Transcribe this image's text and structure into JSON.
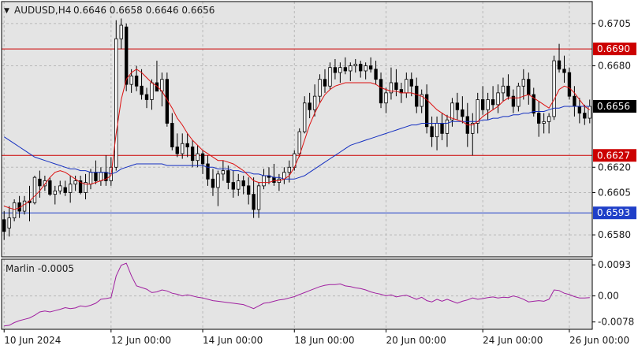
{
  "header": {
    "menu_glyph": "▼",
    "symbol": "AUDUSD,H4",
    "ohlc": "0.6646 0.6658 0.6646 0.6656"
  },
  "indicator": {
    "label": "Marlin -0.0005"
  },
  "colors": {
    "background": "#e4e4e4",
    "bull_body": "#ffffff",
    "bear_body": "#000000",
    "candle_outline": "#000000",
    "red_level": "#cc0000",
    "blue_level": "#1f3fc8",
    "fast_ma": "#dd1010",
    "slow_ma": "#1530c0",
    "marlin": "#a020a0",
    "grid": "#b8b8b8"
  },
  "chart_data": {
    "type": "candlestick",
    "symbol": "AUDUSD",
    "timeframe": "H4",
    "grid": true,
    "ylim": [
      0.6567,
      0.6718
    ],
    "y_ticks": [
      "0.6705",
      "0.6680",
      "0.6620",
      "0.6605",
      "0.6580"
    ],
    "x_ticks": [
      "10 Jun 2024",
      "12 Jun 00:00",
      "14 Jun 00:00",
      "18 Jun 00:00",
      "20 Jun 00:00",
      "24 Jun 00:00",
      "26 Jun 00:00"
    ],
    "x_tick_index": [
      0,
      21,
      39,
      57,
      75,
      94,
      111
    ],
    "levels": [
      {
        "value": 0.669,
        "label": "0.6690",
        "kind": "red"
      },
      {
        "value": 0.6627,
        "label": "0.6627",
        "kind": "red"
      },
      {
        "value": 0.6593,
        "label": "0.6593",
        "kind": "blue"
      }
    ],
    "current_price": {
      "value": 0.6656,
      "label": "0.6656"
    },
    "candles": [
      [
        0.6589,
        0.6594,
        0.6577,
        0.6582
      ],
      [
        0.6584,
        0.6597,
        0.6579,
        0.659
      ],
      [
        0.659,
        0.6601,
        0.6588,
        0.6599
      ],
      [
        0.6599,
        0.6603,
        0.659,
        0.6594
      ],
      [
        0.6594,
        0.6603,
        0.6592,
        0.66
      ],
      [
        0.66,
        0.6609,
        0.6588,
        0.6599
      ],
      [
        0.6599,
        0.6615,
        0.6598,
        0.6614
      ],
      [
        0.6613,
        0.6618,
        0.6602,
        0.6609
      ],
      [
        0.6609,
        0.6615,
        0.6606,
        0.6612
      ],
      [
        0.6612,
        0.6614,
        0.6603,
        0.6604
      ],
      [
        0.6604,
        0.6609,
        0.6598,
        0.6606
      ],
      [
        0.6606,
        0.6612,
        0.6604,
        0.6609
      ],
      [
        0.6608,
        0.6612,
        0.6603,
        0.6605
      ],
      [
        0.6605,
        0.6615,
        0.6599,
        0.661
      ],
      [
        0.661,
        0.6615,
        0.6606,
        0.6612
      ],
      [
        0.6612,
        0.6615,
        0.6604,
        0.6605
      ],
      [
        0.6605,
        0.6616,
        0.6601,
        0.6611
      ],
      [
        0.661,
        0.6619,
        0.6607,
        0.6617
      ],
      [
        0.6617,
        0.6624,
        0.661,
        0.6612
      ],
      [
        0.6612,
        0.662,
        0.6609,
        0.6617
      ],
      [
        0.6617,
        0.6627,
        0.6609,
        0.6612
      ],
      [
        0.6612,
        0.6626,
        0.6609,
        0.662
      ],
      [
        0.662,
        0.6707,
        0.6618,
        0.6696
      ],
      [
        0.6696,
        0.6708,
        0.669,
        0.6704
      ],
      [
        0.6703,
        0.6705,
        0.6665,
        0.6669
      ],
      [
        0.6669,
        0.6678,
        0.6664,
        0.6674
      ],
      [
        0.6674,
        0.668,
        0.6665,
        0.6668
      ],
      [
        0.6668,
        0.6678,
        0.666,
        0.6663
      ],
      [
        0.6663,
        0.6667,
        0.6655,
        0.666
      ],
      [
        0.666,
        0.6672,
        0.6654,
        0.667
      ],
      [
        0.667,
        0.6683,
        0.6665,
        0.6665
      ],
      [
        0.6665,
        0.6676,
        0.6656,
        0.6672
      ],
      [
        0.6672,
        0.6676,
        0.6644,
        0.6646
      ],
      [
        0.6646,
        0.6652,
        0.663,
        0.6632
      ],
      [
        0.6632,
        0.664,
        0.6626,
        0.6628
      ],
      [
        0.6628,
        0.664,
        0.6625,
        0.6634
      ],
      [
        0.6634,
        0.664,
        0.6626,
        0.6632
      ],
      [
        0.6632,
        0.6636,
        0.662,
        0.6624
      ],
      [
        0.6624,
        0.6633,
        0.662,
        0.6628
      ],
      [
        0.6628,
        0.663,
        0.6616,
        0.6622
      ],
      [
        0.6622,
        0.6627,
        0.6609,
        0.6613
      ],
      [
        0.6613,
        0.6619,
        0.6603,
        0.6608
      ],
      [
        0.6608,
        0.6618,
        0.6597,
        0.6616
      ],
      [
        0.6616,
        0.6624,
        0.6612,
        0.6618
      ],
      [
        0.6618,
        0.6621,
        0.6607,
        0.6611
      ],
      [
        0.6611,
        0.6618,
        0.6602,
        0.6607
      ],
      [
        0.6607,
        0.6616,
        0.6603,
        0.6612
      ],
      [
        0.6612,
        0.6615,
        0.6604,
        0.6609
      ],
      [
        0.6609,
        0.6614,
        0.6598,
        0.6604
      ],
      [
        0.6604,
        0.6614,
        0.659,
        0.6595
      ],
      [
        0.6595,
        0.6611,
        0.659,
        0.6609
      ],
      [
        0.6609,
        0.6619,
        0.6607,
        0.6615
      ],
      [
        0.6615,
        0.662,
        0.661,
        0.6614
      ],
      [
        0.6614,
        0.6622,
        0.6609,
        0.6611
      ],
      [
        0.6611,
        0.6616,
        0.6606,
        0.6613
      ],
      [
        0.6613,
        0.662,
        0.661,
        0.6617
      ],
      [
        0.6617,
        0.6624,
        0.6611,
        0.662
      ],
      [
        0.662,
        0.663,
        0.6618,
        0.6628
      ],
      [
        0.6628,
        0.6643,
        0.6626,
        0.6641
      ],
      [
        0.6641,
        0.6662,
        0.664,
        0.6658
      ],
      [
        0.6658,
        0.6664,
        0.6649,
        0.6654
      ],
      [
        0.6654,
        0.6669,
        0.665,
        0.6662
      ],
      [
        0.6662,
        0.6675,
        0.6658,
        0.6672
      ],
      [
        0.6672,
        0.6678,
        0.6664,
        0.6668
      ],
      [
        0.6668,
        0.6682,
        0.6666,
        0.6679
      ],
      [
        0.6679,
        0.6684,
        0.6672,
        0.6676
      ],
      [
        0.6676,
        0.6682,
        0.667,
        0.6679
      ],
      [
        0.6679,
        0.6685,
        0.6675,
        0.6677
      ],
      [
        0.6677,
        0.6682,
        0.6671,
        0.668
      ],
      [
        0.668,
        0.6684,
        0.6676,
        0.6681
      ],
      [
        0.6681,
        0.6683,
        0.6673,
        0.6677
      ],
      [
        0.6677,
        0.6682,
        0.6672,
        0.668
      ],
      [
        0.668,
        0.6685,
        0.6676,
        0.6678
      ],
      [
        0.6678,
        0.6683,
        0.6669,
        0.6672
      ],
      [
        0.6672,
        0.6676,
        0.6655,
        0.6658
      ],
      [
        0.6658,
        0.6667,
        0.6652,
        0.6664
      ],
      [
        0.6664,
        0.6679,
        0.666,
        0.667
      ],
      [
        0.667,
        0.6678,
        0.6662,
        0.6666
      ],
      [
        0.6666,
        0.667,
        0.6658,
        0.6664
      ],
      [
        0.6664,
        0.6676,
        0.6661,
        0.6672
      ],
      [
        0.6672,
        0.6676,
        0.6662,
        0.6668
      ],
      [
        0.6668,
        0.6673,
        0.6652,
        0.6656
      ],
      [
        0.6656,
        0.6666,
        0.6652,
        0.6663
      ],
      [
        0.6663,
        0.6669,
        0.664,
        0.6644
      ],
      [
        0.6644,
        0.665,
        0.6632,
        0.6638
      ],
      [
        0.6638,
        0.665,
        0.663,
        0.6646
      ],
      [
        0.6646,
        0.6652,
        0.6636,
        0.664
      ],
      [
        0.664,
        0.6651,
        0.6632,
        0.6648
      ],
      [
        0.6648,
        0.6661,
        0.6644,
        0.6658
      ],
      [
        0.6658,
        0.6664,
        0.6648,
        0.6654
      ],
      [
        0.6654,
        0.6662,
        0.6646,
        0.665
      ],
      [
        0.665,
        0.6658,
        0.6632,
        0.664
      ],
      [
        0.664,
        0.6652,
        0.6627,
        0.6646
      ],
      [
        0.6646,
        0.6664,
        0.664,
        0.666
      ],
      [
        0.666,
        0.6668,
        0.6651,
        0.6654
      ],
      [
        0.6654,
        0.6664,
        0.6648,
        0.666
      ],
      [
        0.666,
        0.6668,
        0.6654,
        0.6657
      ],
      [
        0.6657,
        0.6669,
        0.6652,
        0.6664
      ],
      [
        0.6664,
        0.6673,
        0.6659,
        0.6668
      ],
      [
        0.6668,
        0.6675,
        0.666,
        0.6662
      ],
      [
        0.6662,
        0.6666,
        0.6652,
        0.6656
      ],
      [
        0.6656,
        0.667,
        0.6653,
        0.6668
      ],
      [
        0.6668,
        0.6678,
        0.666,
        0.6672
      ],
      [
        0.6672,
        0.6676,
        0.6657,
        0.6663
      ],
      [
        0.6663,
        0.6667,
        0.665,
        0.6652
      ],
      [
        0.6652,
        0.6659,
        0.6638,
        0.6646
      ],
      [
        0.6646,
        0.6652,
        0.664,
        0.6647
      ],
      [
        0.6647,
        0.6652,
        0.664,
        0.665
      ],
      [
        0.665,
        0.6686,
        0.6648,
        0.6683
      ],
      [
        0.6683,
        0.6693,
        0.6676,
        0.6678
      ],
      [
        0.6678,
        0.6686,
        0.667,
        0.6676
      ],
      [
        0.6676,
        0.6679,
        0.666,
        0.6662
      ],
      [
        0.6662,
        0.6668,
        0.665,
        0.6656
      ],
      [
        0.6656,
        0.6661,
        0.6646,
        0.6652
      ],
      [
        0.6652,
        0.6657,
        0.6645,
        0.6649
      ],
      [
        0.6649,
        0.666,
        0.6646,
        0.6656
      ]
    ],
    "fast_ma_values": [
      0.6597,
      0.6596,
      0.6595,
      0.6596,
      0.6598,
      0.66,
      0.6603,
      0.6606,
      0.661,
      0.6614,
      0.6617,
      0.6618,
      0.6617,
      0.6615,
      0.6613,
      0.6611,
      0.661,
      0.661,
      0.6611,
      0.6612,
      0.6613,
      0.6615,
      0.664,
      0.666,
      0.6672,
      0.6676,
      0.6678,
      0.6676,
      0.6673,
      0.667,
      0.6668,
      0.6665,
      0.666,
      0.6655,
      0.6649,
      0.6645,
      0.664,
      0.6636,
      0.6633,
      0.663,
      0.6628,
      0.6626,
      0.6624,
      0.6624,
      0.6623,
      0.6622,
      0.662,
      0.6618,
      0.6615,
      0.6612,
      0.6611,
      0.6611,
      0.6611,
      0.6612,
      0.6612,
      0.6613,
      0.6615,
      0.662,
      0.6627,
      0.6636,
      0.6645,
      0.6652,
      0.6658,
      0.6663,
      0.6666,
      0.6668,
      0.6669,
      0.667,
      0.667,
      0.667,
      0.667,
      0.667,
      0.667,
      0.6669,
      0.6667,
      0.6666,
      0.6665,
      0.6665,
      0.6664,
      0.6664,
      0.6664,
      0.6663,
      0.6662,
      0.666,
      0.6657,
      0.6654,
      0.6652,
      0.665,
      0.6649,
      0.6648,
      0.6647,
      0.6645,
      0.6645,
      0.6647,
      0.665,
      0.6652,
      0.6654,
      0.6656,
      0.6659,
      0.6661,
      0.6661,
      0.6661,
      0.6662,
      0.6663,
      0.6661,
      0.6659,
      0.6657,
      0.6655,
      0.666,
      0.6666,
      0.6668,
      0.6667,
      0.6664,
      0.666,
      0.6656,
      0.6654
    ],
    "slow_ma_values": [
      0.6638,
      0.6636,
      0.6634,
      0.6632,
      0.663,
      0.6628,
      0.6626,
      0.6625,
      0.6624,
      0.6623,
      0.6622,
      0.6621,
      0.662,
      0.6619,
      0.6619,
      0.6618,
      0.6618,
      0.6617,
      0.6617,
      0.6617,
      0.6617,
      0.6616,
      0.6617,
      0.6619,
      0.662,
      0.6621,
      0.6622,
      0.6622,
      0.6622,
      0.6622,
      0.6622,
      0.6622,
      0.6621,
      0.6621,
      0.6621,
      0.6621,
      0.6621,
      0.6621,
      0.6621,
      0.6621,
      0.662,
      0.662,
      0.6619,
      0.6619,
      0.6619,
      0.6618,
      0.6618,
      0.6617,
      0.6617,
      0.6616,
      0.6616,
      0.6615,
      0.6615,
      0.6614,
      0.6614,
      0.6613,
      0.6613,
      0.6613,
      0.6614,
      0.6615,
      0.6617,
      0.6619,
      0.6621,
      0.6623,
      0.6625,
      0.6627,
      0.6629,
      0.6631,
      0.6633,
      0.6634,
      0.6635,
      0.6636,
      0.6637,
      0.6638,
      0.6639,
      0.664,
      0.6641,
      0.6642,
      0.6643,
      0.6644,
      0.6645,
      0.6645,
      0.6646,
      0.6646,
      0.6646,
      0.6646,
      0.6646,
      0.6646,
      0.6647,
      0.6647,
      0.6647,
      0.6647,
      0.6647,
      0.6647,
      0.6648,
      0.6648,
      0.6649,
      0.6649,
      0.665,
      0.665,
      0.6651,
      0.6651,
      0.6652,
      0.6652,
      0.6653,
      0.6653,
      0.6653,
      0.6654,
      0.6655,
      0.6655,
      0.6656,
      0.6656,
      0.6656,
      0.6656,
      0.6656,
      0.6656
    ],
    "indicator": {
      "name": "Marlin",
      "ylim": [
        -0.01,
        0.011
      ],
      "y_ticks": [
        "0.0093",
        "0.00",
        "-0.0078"
      ],
      "values": [
        -0.009,
        -0.0088,
        -0.008,
        -0.0074,
        -0.007,
        -0.0066,
        -0.0058,
        -0.0048,
        -0.0045,
        -0.0048,
        -0.0044,
        -0.004,
        -0.0035,
        -0.0038,
        -0.0036,
        -0.003,
        -0.0032,
        -0.0028,
        -0.0022,
        -0.001,
        -0.0008,
        -0.0005,
        0.006,
        0.0092,
        0.0098,
        0.006,
        0.003,
        0.0025,
        0.002,
        0.001,
        0.0012,
        0.0018,
        0.0015,
        0.0008,
        0.0005,
        0.0,
        0.0003,
        0.0,
        -0.0004,
        -0.0006,
        -0.001,
        -0.0014,
        -0.0016,
        -0.0018,
        -0.002,
        -0.0022,
        -0.0024,
        -0.0026,
        -0.0032,
        -0.0038,
        -0.003,
        -0.0022,
        -0.002,
        -0.0016,
        -0.0012,
        -0.001,
        -0.0006,
        -0.0002,
        0.0004,
        0.001,
        0.0016,
        0.0022,
        0.0028,
        0.0032,
        0.0034,
        0.0034,
        0.0036,
        0.003,
        0.0028,
        0.0024,
        0.0022,
        0.0018,
        0.0012,
        0.0008,
        0.0005,
        0.0,
        0.0003,
        -0.0003,
        0.0,
        0.0002,
        -0.0004,
        -0.001,
        -0.0004,
        -0.0014,
        -0.0018,
        -0.001,
        -0.0016,
        -0.001,
        -0.0016,
        -0.0022,
        -0.0016,
        -0.0012,
        -0.0006,
        -0.001,
        -0.0008,
        -0.0005,
        -0.0003,
        -0.0006,
        -0.0004,
        -0.0005,
        0.0,
        -0.0004,
        -0.001,
        -0.0018,
        -0.0016,
        -0.0014,
        -0.0016,
        -0.001,
        0.0018,
        0.0016,
        0.0008,
        0.0004,
        -0.0002,
        -0.0006,
        -0.0006,
        -0.0005
      ]
    }
  }
}
